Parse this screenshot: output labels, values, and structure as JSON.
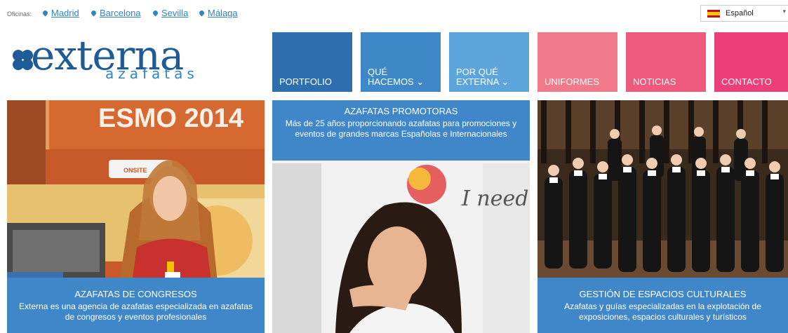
{
  "topbar": {
    "offices_label": "Oficinas:",
    "offices": [
      "Madrid",
      "Barcelona",
      "Sevilla",
      "Málaga"
    ],
    "language": {
      "label": "Español",
      "flag": "spain-flag-icon"
    }
  },
  "logo": {
    "word": "externa",
    "sub": "azafatas",
    "color": "#1f5b97"
  },
  "nav": [
    {
      "label": "PORTFOLIO",
      "color": "#2e6fb0"
    },
    {
      "label": "QUÉ\nHACEMOS ⌄",
      "color": "#3f88c8"
    },
    {
      "label": "POR QUÉ\nEXTERNA ⌄",
      "color": "#5ba5dc"
    },
    {
      "label": "UNIFORMES",
      "color": "#f07a8a"
    },
    {
      "label": "NOTICIAS",
      "color": "#ee5a7e"
    },
    {
      "label": "CONTACTO",
      "color": "#ec3e78"
    }
  ],
  "tiles": [
    {
      "title": "AZAFATAS DE CONGRESOS",
      "desc": "Externa es una agencia de azafatas especializada en azafatas de congresos y eventos profesionales",
      "photo_text": "ESMO 2014",
      "badge_text": "ONSITE"
    },
    {
      "title": "AZAFATAS PROMOTORAS",
      "desc": "Más de 25 años proporcionando azafatas para promociones y eventos de grandes marcas Españolas e Internacionales",
      "photo_text": "I need Spain"
    },
    {
      "title": "GESTIÓN DE ESPACIOS CULTURALES",
      "desc": "Azafatas y guías especializadas en la explotación de exposiciones, espacios culturales y turísticos"
    }
  ],
  "colors": {
    "accent_blue": "#3f87c9",
    "link": "#2f86c4"
  }
}
